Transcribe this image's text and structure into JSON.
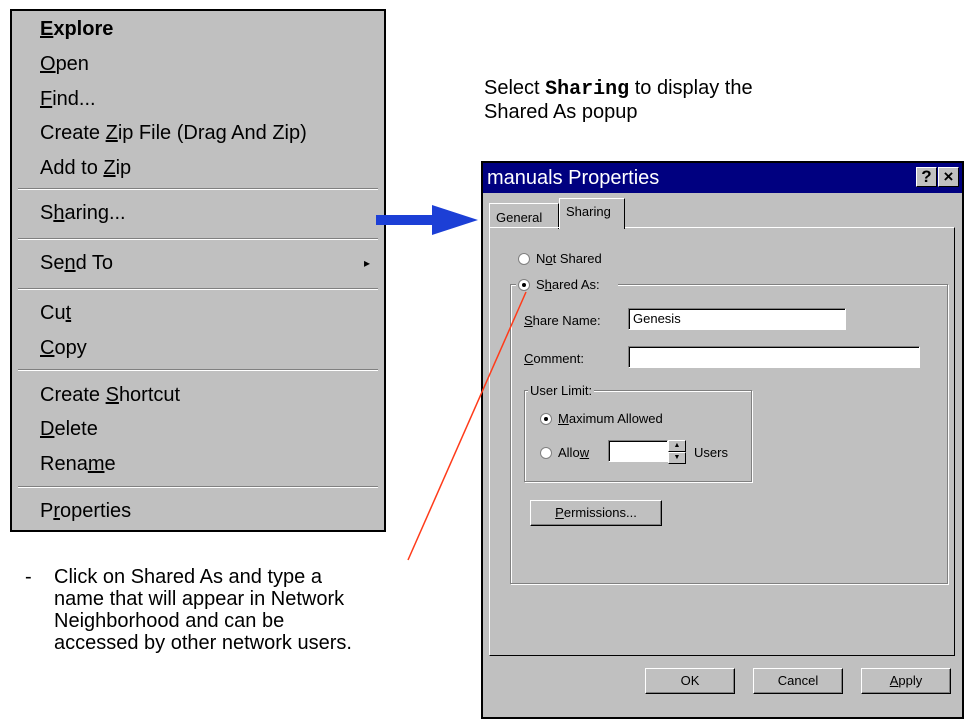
{
  "context_menu": {
    "items": [
      {
        "pre": "",
        "u": "E",
        "post": "xplore"
      },
      {
        "pre": "",
        "u": "O",
        "post": "pen"
      },
      {
        "pre": "",
        "u": "F",
        "post": "ind..."
      },
      {
        "pre": "Create ",
        "u": "Z",
        "post": "ip File (Drag And Zip)"
      },
      {
        "pre": "Add to ",
        "u": "Z",
        "post": "ip"
      },
      {
        "pre": "S",
        "u": "h",
        "post": "aring..."
      },
      {
        "pre": "Se",
        "u": "n",
        "post": "d To"
      },
      {
        "pre": "Cu",
        "u": "t",
        "post": ""
      },
      {
        "pre": "",
        "u": "C",
        "post": "opy"
      },
      {
        "pre": "Create ",
        "u": "S",
        "post": "hortcut"
      },
      {
        "pre": "",
        "u": "D",
        "post": "elete"
      },
      {
        "pre": "Rena",
        "u": "m",
        "post": "e"
      },
      {
        "pre": "P",
        "u": "r",
        "post": "operties"
      }
    ],
    "submenu_arrow": "▸"
  },
  "caption_top": {
    "line1_pre": "Select ",
    "line1_code": "Sharing",
    "line1_post": " to display the",
    "line2": "Shared As popup"
  },
  "caption_bottom": {
    "bullet": "-",
    "lines": [
      "Click on Shared As and type a",
      "name that will appear in Network",
      "Neighborhood and can be",
      "accessed by other network users."
    ]
  },
  "dialog": {
    "title": "manuals Properties",
    "help_btn": "?",
    "close_btn": "×",
    "tabs": [
      "General",
      "Sharing"
    ],
    "not_shared": {
      "pre": "N",
      "u": "o",
      "post": "t Shared"
    },
    "shared_as": {
      "pre": "S",
      "u": "h",
      "post": "ared As:"
    },
    "share_name_label": {
      "pre": "",
      "u": "S",
      "post": "hare Name:"
    },
    "share_name_value": "Genesis",
    "comment_label": {
      "pre": "",
      "u": "C",
      "post": "omment:"
    },
    "comment_value": "",
    "user_limit_label": "User Limit:",
    "max_allowed": {
      "pre": "",
      "u": "M",
      "post": "aximum Allowed"
    },
    "allow": {
      "pre": "Allo",
      "u": "w",
      "post": ""
    },
    "users_label": "Users",
    "allow_value": "",
    "permissions_btn": {
      "pre": "",
      "u": "P",
      "post": "ermissions..."
    },
    "ok_btn": "OK",
    "cancel_btn": "Cancel",
    "apply_btn": {
      "pre": "",
      "u": "A",
      "post": "pply"
    }
  },
  "colors": {
    "menu_bg": "#c0c0c0",
    "titlebar": "#000080",
    "arrow": "#1c3fd6",
    "pointer_line": "#ff3b1a"
  }
}
